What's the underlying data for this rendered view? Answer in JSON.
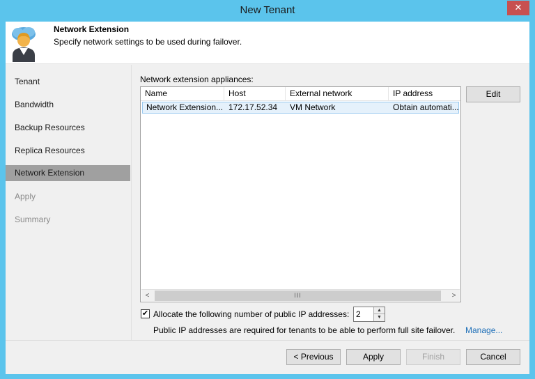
{
  "window": {
    "title": "New Tenant",
    "close_glyph": "✕"
  },
  "header": {
    "title": "Network Extension",
    "subtitle": "Specify network settings to be used during failover.",
    "icon": "tenant-avatar-icon"
  },
  "sidebar": {
    "items": [
      {
        "label": "Tenant",
        "state": "normal"
      },
      {
        "label": "Bandwidth",
        "state": "normal"
      },
      {
        "label": "Backup Resources",
        "state": "normal"
      },
      {
        "label": "Replica Resources",
        "state": "normal"
      },
      {
        "label": "Network Extension",
        "state": "active"
      },
      {
        "label": "Apply",
        "state": "disabled"
      },
      {
        "label": "Summary",
        "state": "disabled"
      }
    ]
  },
  "appliances": {
    "label": "Network extension appliances:",
    "columns": [
      "Name",
      "Host",
      "External network",
      "IP address"
    ],
    "rows": [
      [
        "Network Extension...",
        "172.17.52.34",
        "VM Network",
        "Obtain automati..."
      ]
    ],
    "edit_label": "Edit",
    "scroll_left": "<",
    "scroll_right": ">",
    "scroll_grip": "III"
  },
  "public_ip": {
    "checked": true,
    "check_glyph": "✔",
    "label": "Allocate the following number of public IP addresses:",
    "count": "2",
    "note": "Public IP addresses are required for tenants to be able to perform full site failover.",
    "manage_label": "Manage..."
  },
  "footer": {
    "previous_label": "< Previous",
    "apply_label": "Apply",
    "finish_label": "Finish",
    "cancel_label": "Cancel"
  },
  "colors": {
    "titlebar": "#5bc4ec",
    "selected_row": "#e5f1fb",
    "active_nav": "#a0a0a0",
    "link": "#1e6fb8"
  }
}
